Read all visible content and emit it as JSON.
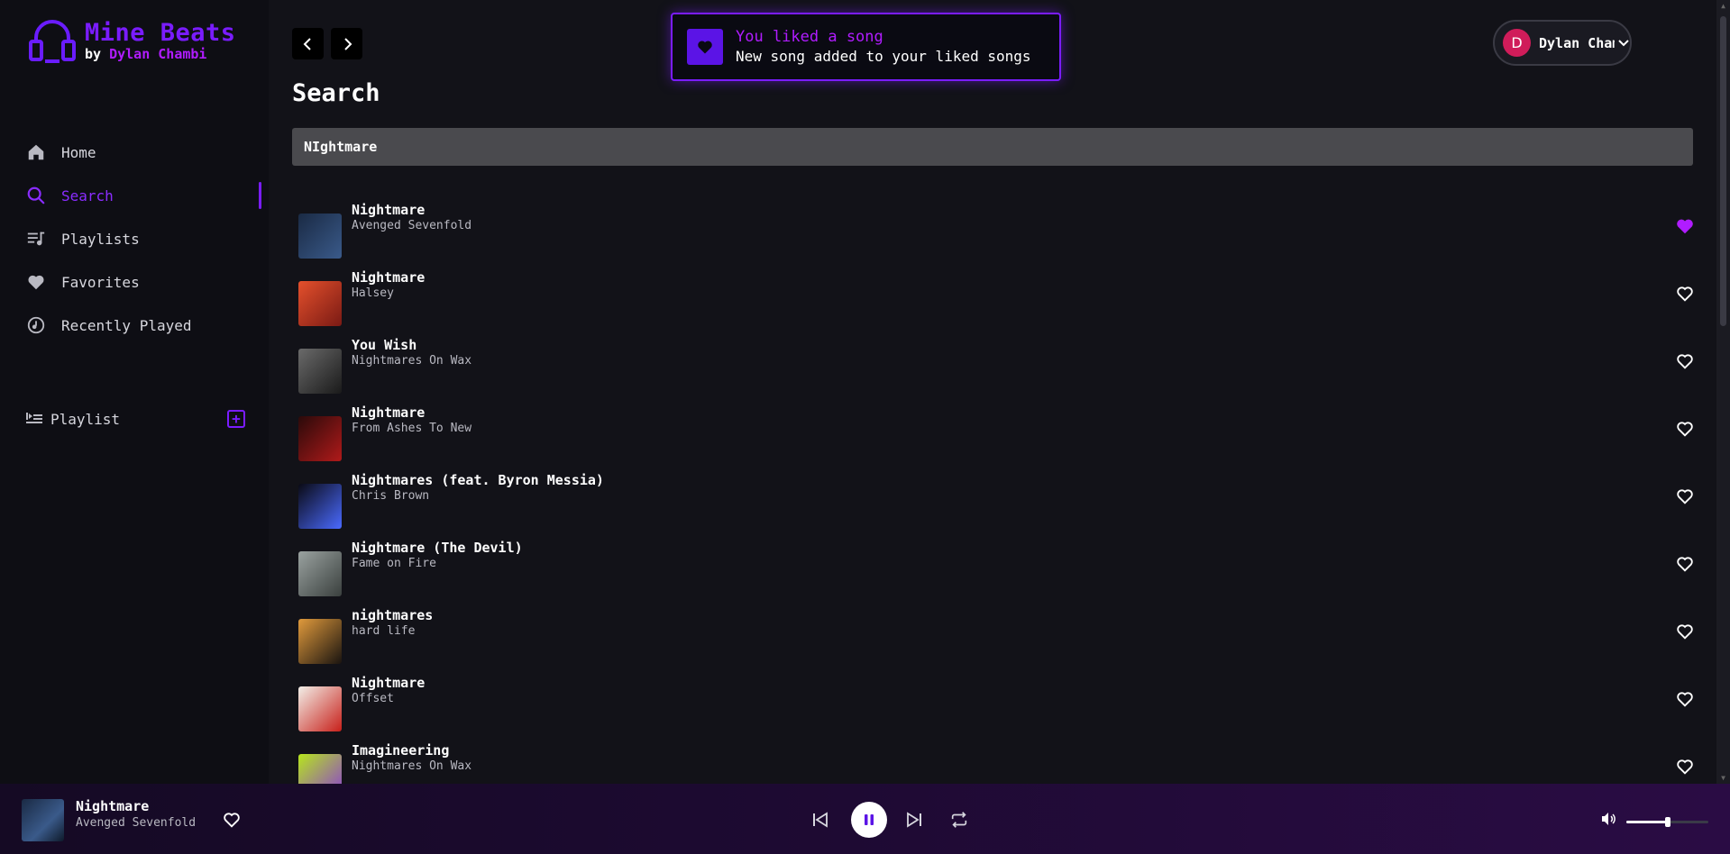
{
  "app": {
    "name": "Mine Beats",
    "by_prefix": "by",
    "author": "Dylan Chambi"
  },
  "sidebar": {
    "items": [
      {
        "label": "Home",
        "icon": "home-icon",
        "active": false
      },
      {
        "label": "Search",
        "icon": "search-icon",
        "active": true
      },
      {
        "label": "Playlists",
        "icon": "playlist-icon",
        "active": false
      },
      {
        "label": "Favorites",
        "icon": "heart-icon",
        "active": false
      },
      {
        "label": "Recently Played",
        "icon": "history-icon",
        "active": false
      }
    ],
    "playlist_section": {
      "label": "Playlist",
      "add_icon": "plus-square-icon"
    }
  },
  "header": {
    "back_icon": "chevron-left-icon",
    "forward_icon": "chevron-right-icon",
    "title": "Search"
  },
  "search": {
    "value": "NIghtmare",
    "placeholder": ""
  },
  "toast": {
    "title": "You liked a song",
    "message": "New song added to your liked songs",
    "icon": "heart-icon"
  },
  "user": {
    "initial": "D",
    "name": "Dylan Chambi F",
    "avatar_color": "#d01c5a"
  },
  "results": [
    {
      "title": "Nightmare",
      "artist": "Avenged Sevenfold",
      "liked": true,
      "cover_colors": [
        "#1a2a44",
        "#3a5a8a"
      ]
    },
    {
      "title": "Nightmare",
      "artist": "Halsey",
      "liked": false,
      "cover_colors": [
        "#e4502c",
        "#7a1a14"
      ]
    },
    {
      "title": "You Wish",
      "artist": "Nightmares On Wax",
      "liked": false,
      "cover_colors": [
        "#6a6a6a",
        "#1a1a1a"
      ]
    },
    {
      "title": "Nightmare",
      "artist": "From Ashes To New",
      "liked": false,
      "cover_colors": [
        "#2a0a0a",
        "#b01a1a"
      ]
    },
    {
      "title": "Nightmares (feat. Byron Messia)",
      "artist": "Chris Brown",
      "liked": false,
      "cover_colors": [
        "#0a0a14",
        "#4a6aff"
      ]
    },
    {
      "title": "Nightmare (The Devil)",
      "artist": "Fame on Fire",
      "liked": false,
      "cover_colors": [
        "#9aa2a0",
        "#3a403e"
      ]
    },
    {
      "title": "nightmares",
      "artist": "hard life",
      "liked": false,
      "cover_colors": [
        "#e09a3c",
        "#1a1410"
      ]
    },
    {
      "title": "Nightmare",
      "artist": "Offset",
      "liked": false,
      "cover_colors": [
        "#f2efe8",
        "#c8201a"
      ]
    },
    {
      "title": "Imagineering",
      "artist": "Nightmares On Wax",
      "liked": false,
      "cover_colors": [
        "#b6e61c",
        "#8a3cd6"
      ]
    }
  ],
  "player": {
    "title": "Nightmare",
    "artist": "Avenged Sevenfold",
    "liked": false,
    "state": "playing",
    "volume": 0.5,
    "icons": [
      "previous-icon",
      "pause-icon",
      "next-icon",
      "repeat-icon",
      "volume-icon"
    ]
  },
  "colors": {
    "accent": "#7a1cff",
    "accent_pink": "#b01cff",
    "background": "#121218",
    "sidebar": "#0e0e14"
  }
}
